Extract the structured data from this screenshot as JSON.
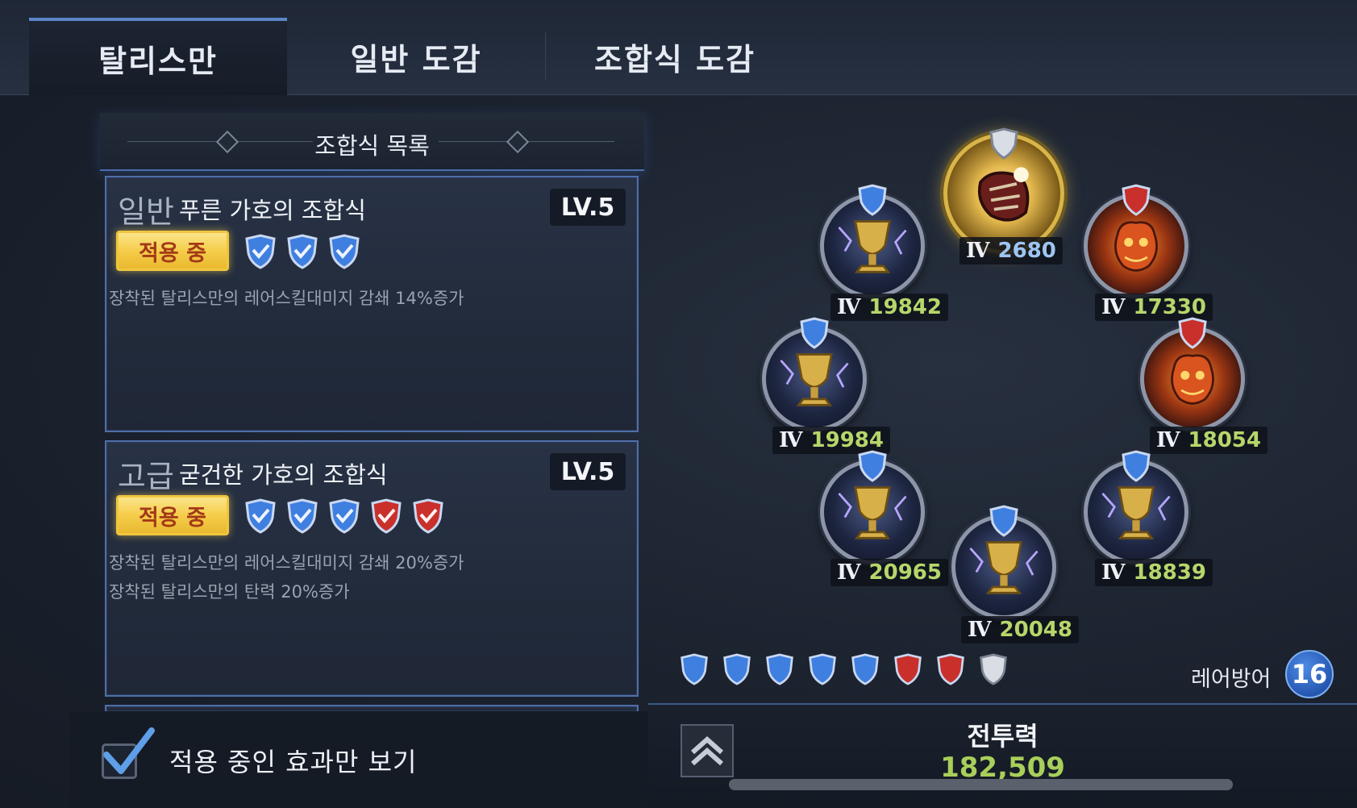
{
  "tabs": [
    {
      "label": "탈리스만",
      "active": true
    },
    {
      "label": "일반 도감",
      "active": false
    },
    {
      "label": "조합식 도감",
      "active": false
    }
  ],
  "list": {
    "title": "조합식 목록",
    "cards": [
      {
        "tier": "일반",
        "name": "푸른 가호의 조합식",
        "level": "LV.5",
        "status": "적용 중",
        "gems": [
          "blue",
          "blue",
          "blue"
        ],
        "effects": [
          "장착된 탈리스만의 레어스킬대미지 감쇄 14%증가"
        ]
      },
      {
        "tier": "고급",
        "name": "굳건한 가호의 조합식",
        "level": "LV.5",
        "status": "적용 중",
        "gems": [
          "blue",
          "blue",
          "blue",
          "red",
          "red"
        ],
        "effects": [
          "장착된 탈리스만의 레어스킬대미지 감쇄 20%증가",
          "장착된 탈리스만의 탄력 20%증가"
        ]
      }
    ]
  },
  "filter": {
    "label": "적용 중인 효과만 보기",
    "checked": true
  },
  "talismans": {
    "center": {
      "roman": "Ⅳ",
      "value": "2680",
      "gem": "silver",
      "icon": "gauntlet-icon"
    },
    "upper_left": {
      "roman": "Ⅳ",
      "value": "19842",
      "gem": "blue",
      "icon": "grail-icon"
    },
    "upper_right": {
      "roman": "Ⅳ",
      "value": "17330",
      "gem": "red",
      "icon": "flame-beast-icon"
    },
    "mid_left": {
      "roman": "Ⅳ",
      "value": "19984",
      "gem": "blue",
      "icon": "grail-icon"
    },
    "mid_right": {
      "roman": "Ⅳ",
      "value": "18054",
      "gem": "red",
      "icon": "flame-beast-icon"
    },
    "lower_left": {
      "roman": "Ⅳ",
      "value": "20965",
      "gem": "blue",
      "icon": "grail-icon"
    },
    "lower_right": {
      "roman": "Ⅳ",
      "value": "18839",
      "gem": "blue",
      "icon": "grail-icon"
    },
    "bottom": {
      "roman": "Ⅳ",
      "value": "20048",
      "gem": "blue",
      "icon": "grail-icon"
    }
  },
  "gem_summary": [
    "blue",
    "blue",
    "blue",
    "blue",
    "blue",
    "red",
    "red",
    "silver"
  ],
  "defense": {
    "label": "레어방어",
    "value": "16"
  },
  "power": {
    "label": "전투력",
    "value": "182,509"
  },
  "colors": {
    "accent": "#5b86c6",
    "badge": "#f5cd4a",
    "power": "#a8cf5a",
    "gem_blue": "#3f7fe0",
    "gem_red": "#c9302c",
    "gem_silver": "#d9dde4"
  }
}
